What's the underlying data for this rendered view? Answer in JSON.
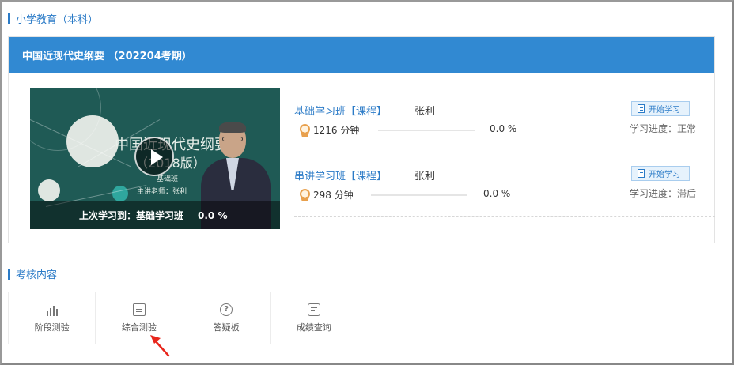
{
  "category": {
    "title": "小学教育（本科）"
  },
  "course": {
    "title": "中国近现代史纲要 （202204考期）",
    "video": {
      "thumb_title": "中国近现代史纲要",
      "thumb_subtitle": "（2018版）",
      "thumb_class": "基础班",
      "thumb_teacher": "主讲老师：张利",
      "last_study_label": "上次学习到：基础学习班",
      "last_study_percent": "0.0 %"
    },
    "lessons": [
      {
        "name": "基础学习班【课程】",
        "teacher": "张利",
        "duration": "1216 分钟",
        "progress_text": "0.0 %",
        "progress_value": 0,
        "start_label": "开始学习",
        "status": "学习进度：正常"
      },
      {
        "name": "串讲学习班【课程】",
        "teacher": "张利",
        "duration": "298 分钟",
        "progress_text": "0.0 %",
        "progress_value": 0,
        "start_label": "开始学习",
        "status": "学习进度：滞后"
      }
    ]
  },
  "exam": {
    "title": "考核内容",
    "items": [
      {
        "label": "阶段测验",
        "icon": "bar-chart-icon"
      },
      {
        "label": "综合测验",
        "icon": "document-icon"
      },
      {
        "label": "答疑板",
        "icon": "question-icon"
      },
      {
        "label": "成绩查询",
        "icon": "message-icon"
      }
    ]
  },
  "colors": {
    "accent": "#3189d2",
    "link": "#2b7bc7",
    "medal": "#e8a04d",
    "arrow": "#e8261c"
  }
}
